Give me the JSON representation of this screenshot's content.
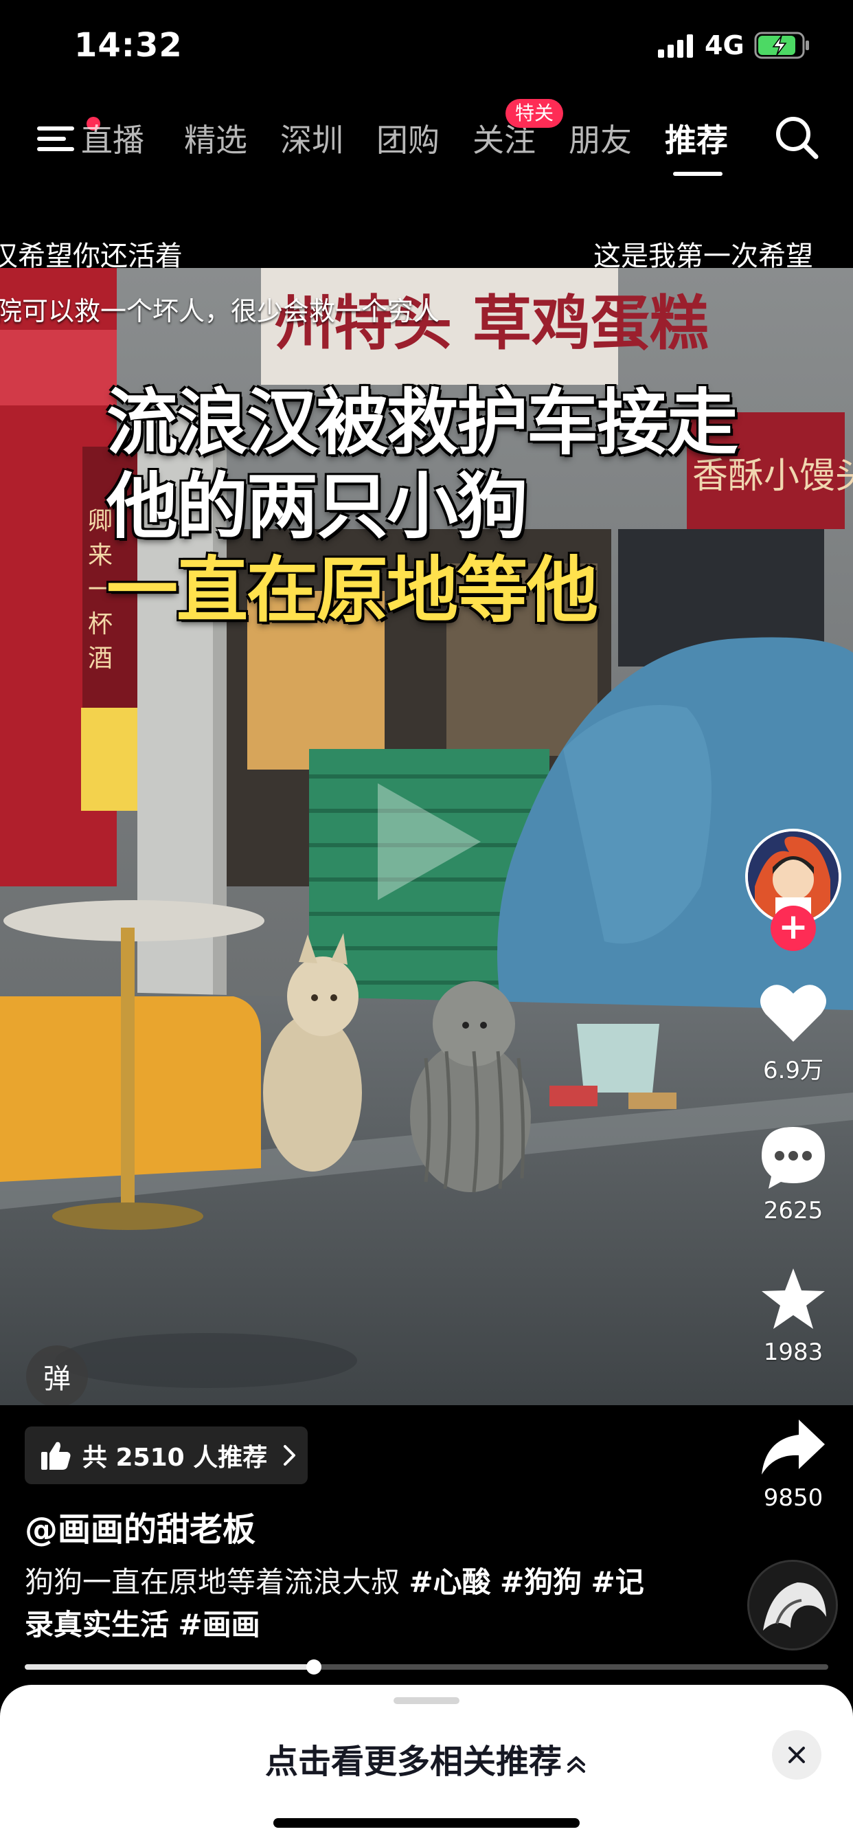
{
  "status_bar": {
    "time": "14:32",
    "network": "4G"
  },
  "top_nav": {
    "tabs": [
      {
        "label": "直播"
      },
      {
        "label": "精选"
      },
      {
        "label": "深圳"
      },
      {
        "label": "团购"
      },
      {
        "label": "关注"
      },
      {
        "label": "朋友"
      },
      {
        "label": "推荐"
      }
    ],
    "follow_badge": "特关"
  },
  "danmaku": [
    "汉希望你还活着",
    "这是我第一次希望",
    "院可以救一个坏人，很少会救一个穷人"
  ],
  "video": {
    "caption_lines": [
      "流浪汉被救护车接走",
      "他的两只小狗",
      "一直在原地等他"
    ],
    "danmaku_toggle": "弹",
    "playback_progress": 0.36
  },
  "rail": {
    "likes": "6.9万",
    "comments": "2625",
    "favorites": "1983",
    "shares": "9850"
  },
  "info": {
    "recommend_text": "共 2510 人推荐",
    "author": "@画画的甜老板",
    "description_text": "狗狗一直在原地等着流浪大叔",
    "hashtags": [
      "#心酸",
      "#狗狗",
      "#记录真实生活",
      "#画画"
    ]
  },
  "sheet": {
    "label": "点击看更多相关推荐"
  },
  "colors": {
    "accent": "#fe2c55",
    "caption_yellow": "#ffe14d"
  }
}
